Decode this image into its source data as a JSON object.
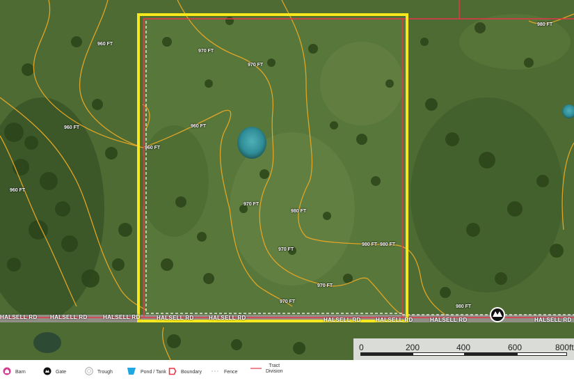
{
  "map": {
    "roads": [
      {
        "name": "HALSELL RD"
      },
      {
        "name": "HALSELL RD"
      },
      {
        "name": "HALSELL RD"
      },
      {
        "name": "HALSELL RD"
      },
      {
        "name": "HALSELL RD"
      },
      {
        "name": "HALSELL RD"
      },
      {
        "name": "HALSELL RD"
      },
      {
        "name": "HALSELL RD"
      },
      {
        "name": "HALSELL RD"
      }
    ],
    "contours": [
      "960 FT",
      "960 FT",
      "970 FT",
      "970 FT",
      "970 FT",
      "970 FT",
      "980 FT",
      "980 FT",
      "980 FT",
      "960 FT",
      "960 FT",
      "960 FT",
      "970 FT",
      "970 FT",
      "980 FT",
      "980 FT"
    ],
    "colors": {
      "boundary": "#f7e81e",
      "tract_division": "#e8354a",
      "fence": "#ffffff",
      "contour": "#e0a526",
      "pond": "#3a8f9c"
    }
  },
  "scale": {
    "ticks": [
      "0",
      "200",
      "400",
      "600",
      "800ft"
    ]
  },
  "legend": {
    "items": [
      {
        "label": "Barn",
        "icon": "barn-icon"
      },
      {
        "label": "Gate",
        "icon": "gate-icon"
      },
      {
        "label": "Trough",
        "icon": "trough-icon"
      },
      {
        "label": "Pond / Tank",
        "icon": "pond-icon"
      },
      {
        "label": "Boundary",
        "icon": "boundary-icon"
      },
      {
        "label": "Fence",
        "icon": "fence-icon"
      },
      {
        "label": "Tract\nDivision",
        "icon": "tract-division-icon"
      }
    ]
  }
}
